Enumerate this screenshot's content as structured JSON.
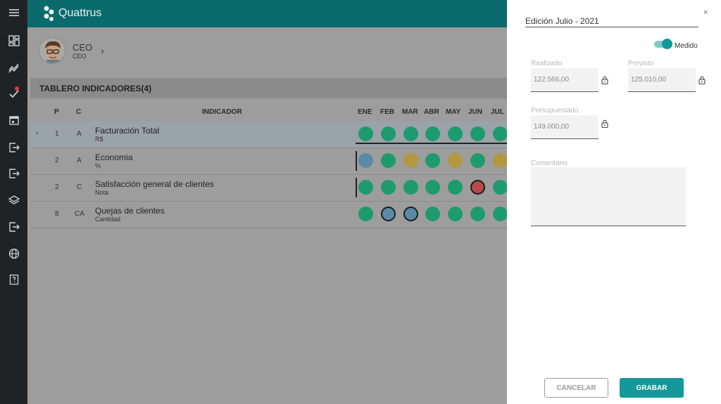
{
  "app": {
    "name": "Quattrus"
  },
  "rail": {
    "icons": [
      "menu-icon",
      "dashboard-icon",
      "trend-icon",
      "tasks-icon",
      "calendar-icon",
      "export-icon",
      "export-icon-2",
      "layers-icon",
      "export-icon-3",
      "globe-icon",
      "help-book-icon"
    ]
  },
  "profile": {
    "name": "CEO",
    "role": "CEO"
  },
  "dashboard": {
    "title": "TABLERO INDICADORES(4)",
    "columns": {
      "p": "P",
      "c": "C",
      "indicador": "INDICADOR"
    },
    "months": [
      "ENE",
      "FEB",
      "MAR",
      "ABR",
      "MAY",
      "JUN",
      "JUL"
    ],
    "rows": [
      {
        "p": "1",
        "c": "A",
        "title": "Facturación Total",
        "unit": "R$",
        "status": [
          "green",
          "green",
          "green",
          "green",
          "green",
          "green",
          "green"
        ]
      },
      {
        "p": "2",
        "c": "A",
        "title": "Economia",
        "unit": "%",
        "status": [
          "blue",
          "green",
          "yellow",
          "green",
          "yellow",
          "green",
          "yellow"
        ]
      },
      {
        "p": "2",
        "c": "C",
        "title": "Satisfacción general de clientes",
        "unit": "Nota",
        "status": [
          "green",
          "green",
          "green",
          "green",
          "green",
          "red",
          "green"
        ]
      },
      {
        "p": "8",
        "c": "CA",
        "title": "Quejas de clientes",
        "unit": "Cantidad",
        "status": [
          "green",
          "blue",
          "blue",
          "green",
          "green",
          "green",
          "green"
        ]
      }
    ]
  },
  "colors": {
    "green": "#1e9a6f",
    "blue": "#5a8aa6",
    "yellow": "#b3983f",
    "red": "#b8494d",
    "teal": "#14989a"
  },
  "panel": {
    "title": "Edición Julio - 2021",
    "close": "×",
    "toggle_label": "Medido",
    "toggle_on": true,
    "realizado_label": "Realizado",
    "realizado_value": "122.566,00",
    "previsto_label": "Previsto",
    "previsto_value": "125.010,00",
    "presupuestado_label": "Presupuestado",
    "presupuestado_value": "149.000,00",
    "comentario_label": "Comentario",
    "cancel": "CANCELAR",
    "save": "GRABAR"
  }
}
